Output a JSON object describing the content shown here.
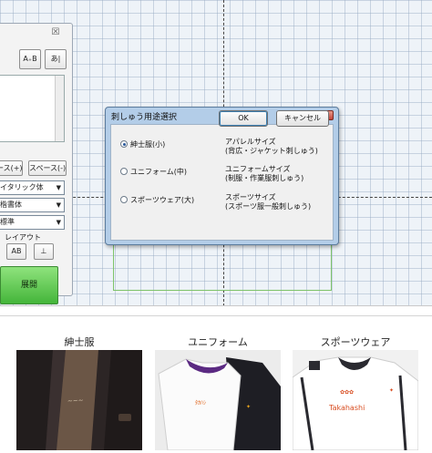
{
  "dialog": {
    "title": "刺しゅう用途選択",
    "close_label": "✕",
    "options": [
      {
        "label": "紳士服(小)",
        "description_line1": "アパレルサイズ",
        "description_line2": "(背広・ジャケット刺しゅう)",
        "selected": true
      },
      {
        "label": "ユニフォーム(中)",
        "description_line1": "ユニフォームサイズ",
        "description_line2": "(制服・作業服刺しゅう)",
        "selected": false
      },
      {
        "label": "スポーツウェア(大)",
        "description_line1": "スポーツサイズ",
        "description_line2": "(スポーツ服一般刺しゅう)",
        "selected": false
      }
    ],
    "ok_label": "OK",
    "cancel_label": "キャンセル"
  },
  "left_panel": {
    "close_label": "☒",
    "tool_button_1": "A₊B",
    "tool_button_2": "あ|",
    "space_plus": "ース(+)",
    "space_minus": "スペース(-)",
    "font_select": "イタリック体",
    "style_select": "楷書体",
    "size_select": "標準",
    "layout_label": "レイアウト",
    "layout_button_1": "AB",
    "layout_button_2": "⊥",
    "expand_button": "展開"
  },
  "captions": {
    "gentleman": "紳士服",
    "uniform": "ユニフォーム",
    "sportswear": "スポーツウェア"
  },
  "photo_texts": {
    "uniform_embroidery": "ﾀｶﾊｼ",
    "sportswear_embroidery": "Takahashi"
  },
  "colors": {
    "dialog_title_bar": "#b3cde8",
    "expand_button": "#5cc24f",
    "embroidery_area_border": "#7ec36a",
    "close_button": "#c3443a"
  }
}
